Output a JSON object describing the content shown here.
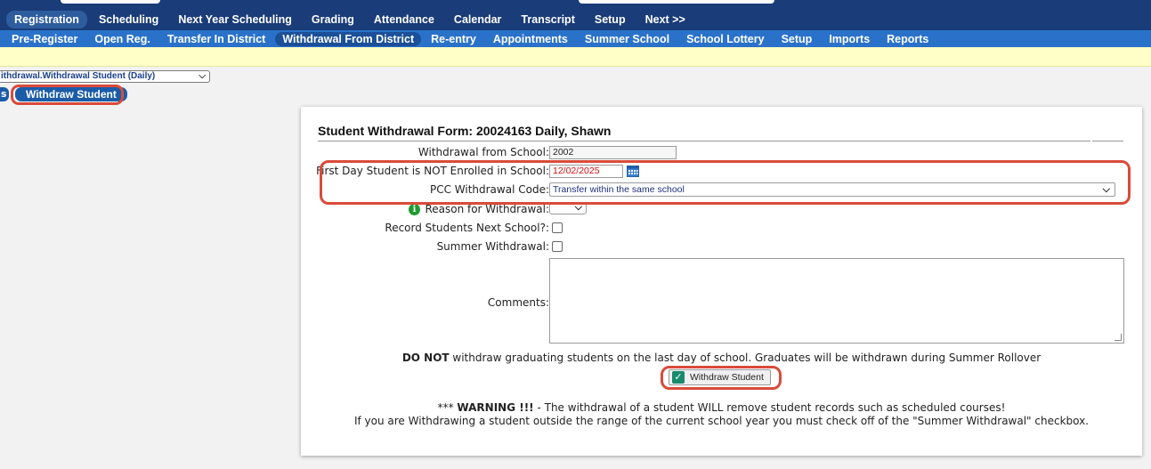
{
  "nav_primary": [
    "Registration",
    "Scheduling",
    "Next Year Scheduling",
    "Grading",
    "Attendance",
    "Calendar",
    "Transcript",
    "Setup",
    "Next >>"
  ],
  "nav_secondary": [
    "Pre-Register",
    "Open Reg.",
    "Transfer In District",
    "Withdrawal From District",
    "Re-entry",
    "Appointments",
    "Summer School",
    "School Lottery",
    "Setup",
    "Imports",
    "Reports"
  ],
  "page_selector": {
    "value": "ithdrawal.Withdrawal Student (Daily)"
  },
  "tabs": {
    "prev_partial": "s",
    "active": "Withdraw Student"
  },
  "form": {
    "title": "Student Withdrawal Form: 20024163 Daily, Shawn",
    "fields": {
      "school_label": "Withdrawal from School:",
      "school_value": "2002",
      "first_day_label": "First Day Student is NOT Enrolled in School:",
      "first_day_value": "12/02/2025",
      "pcc_label": "PCC Withdrawal Code:",
      "pcc_value": "Transfer within the same school",
      "reason_label": "Reason for Withdrawal:",
      "next_school_label": "Record Students Next School?:",
      "summer_label": "Summer Withdrawal:",
      "comments_label": "Comments:"
    },
    "notice_bold": "DO NOT",
    "notice_rest": " withdraw graduating students on the last day of school. Graduates will be withdrawn during Summer Rollover",
    "button_label": "Withdraw Student",
    "warning_line1_prefix": "*** ",
    "warning_line1_bold": "WARNING !!!",
    "warning_line1_rest": " - The withdrawal of a student WILL remove student records such as scheduled courses!",
    "warning_line2": "If you are Withdrawing a student outside the range of the current school year you must check off of the \"Summer Withdrawal\" checkbox."
  },
  "colors": {
    "nav_primary_bg": "#1a3c78",
    "nav_secondary_bg": "#2a72c9",
    "highlight": "#d94b3a",
    "date_text": "#d01010"
  }
}
